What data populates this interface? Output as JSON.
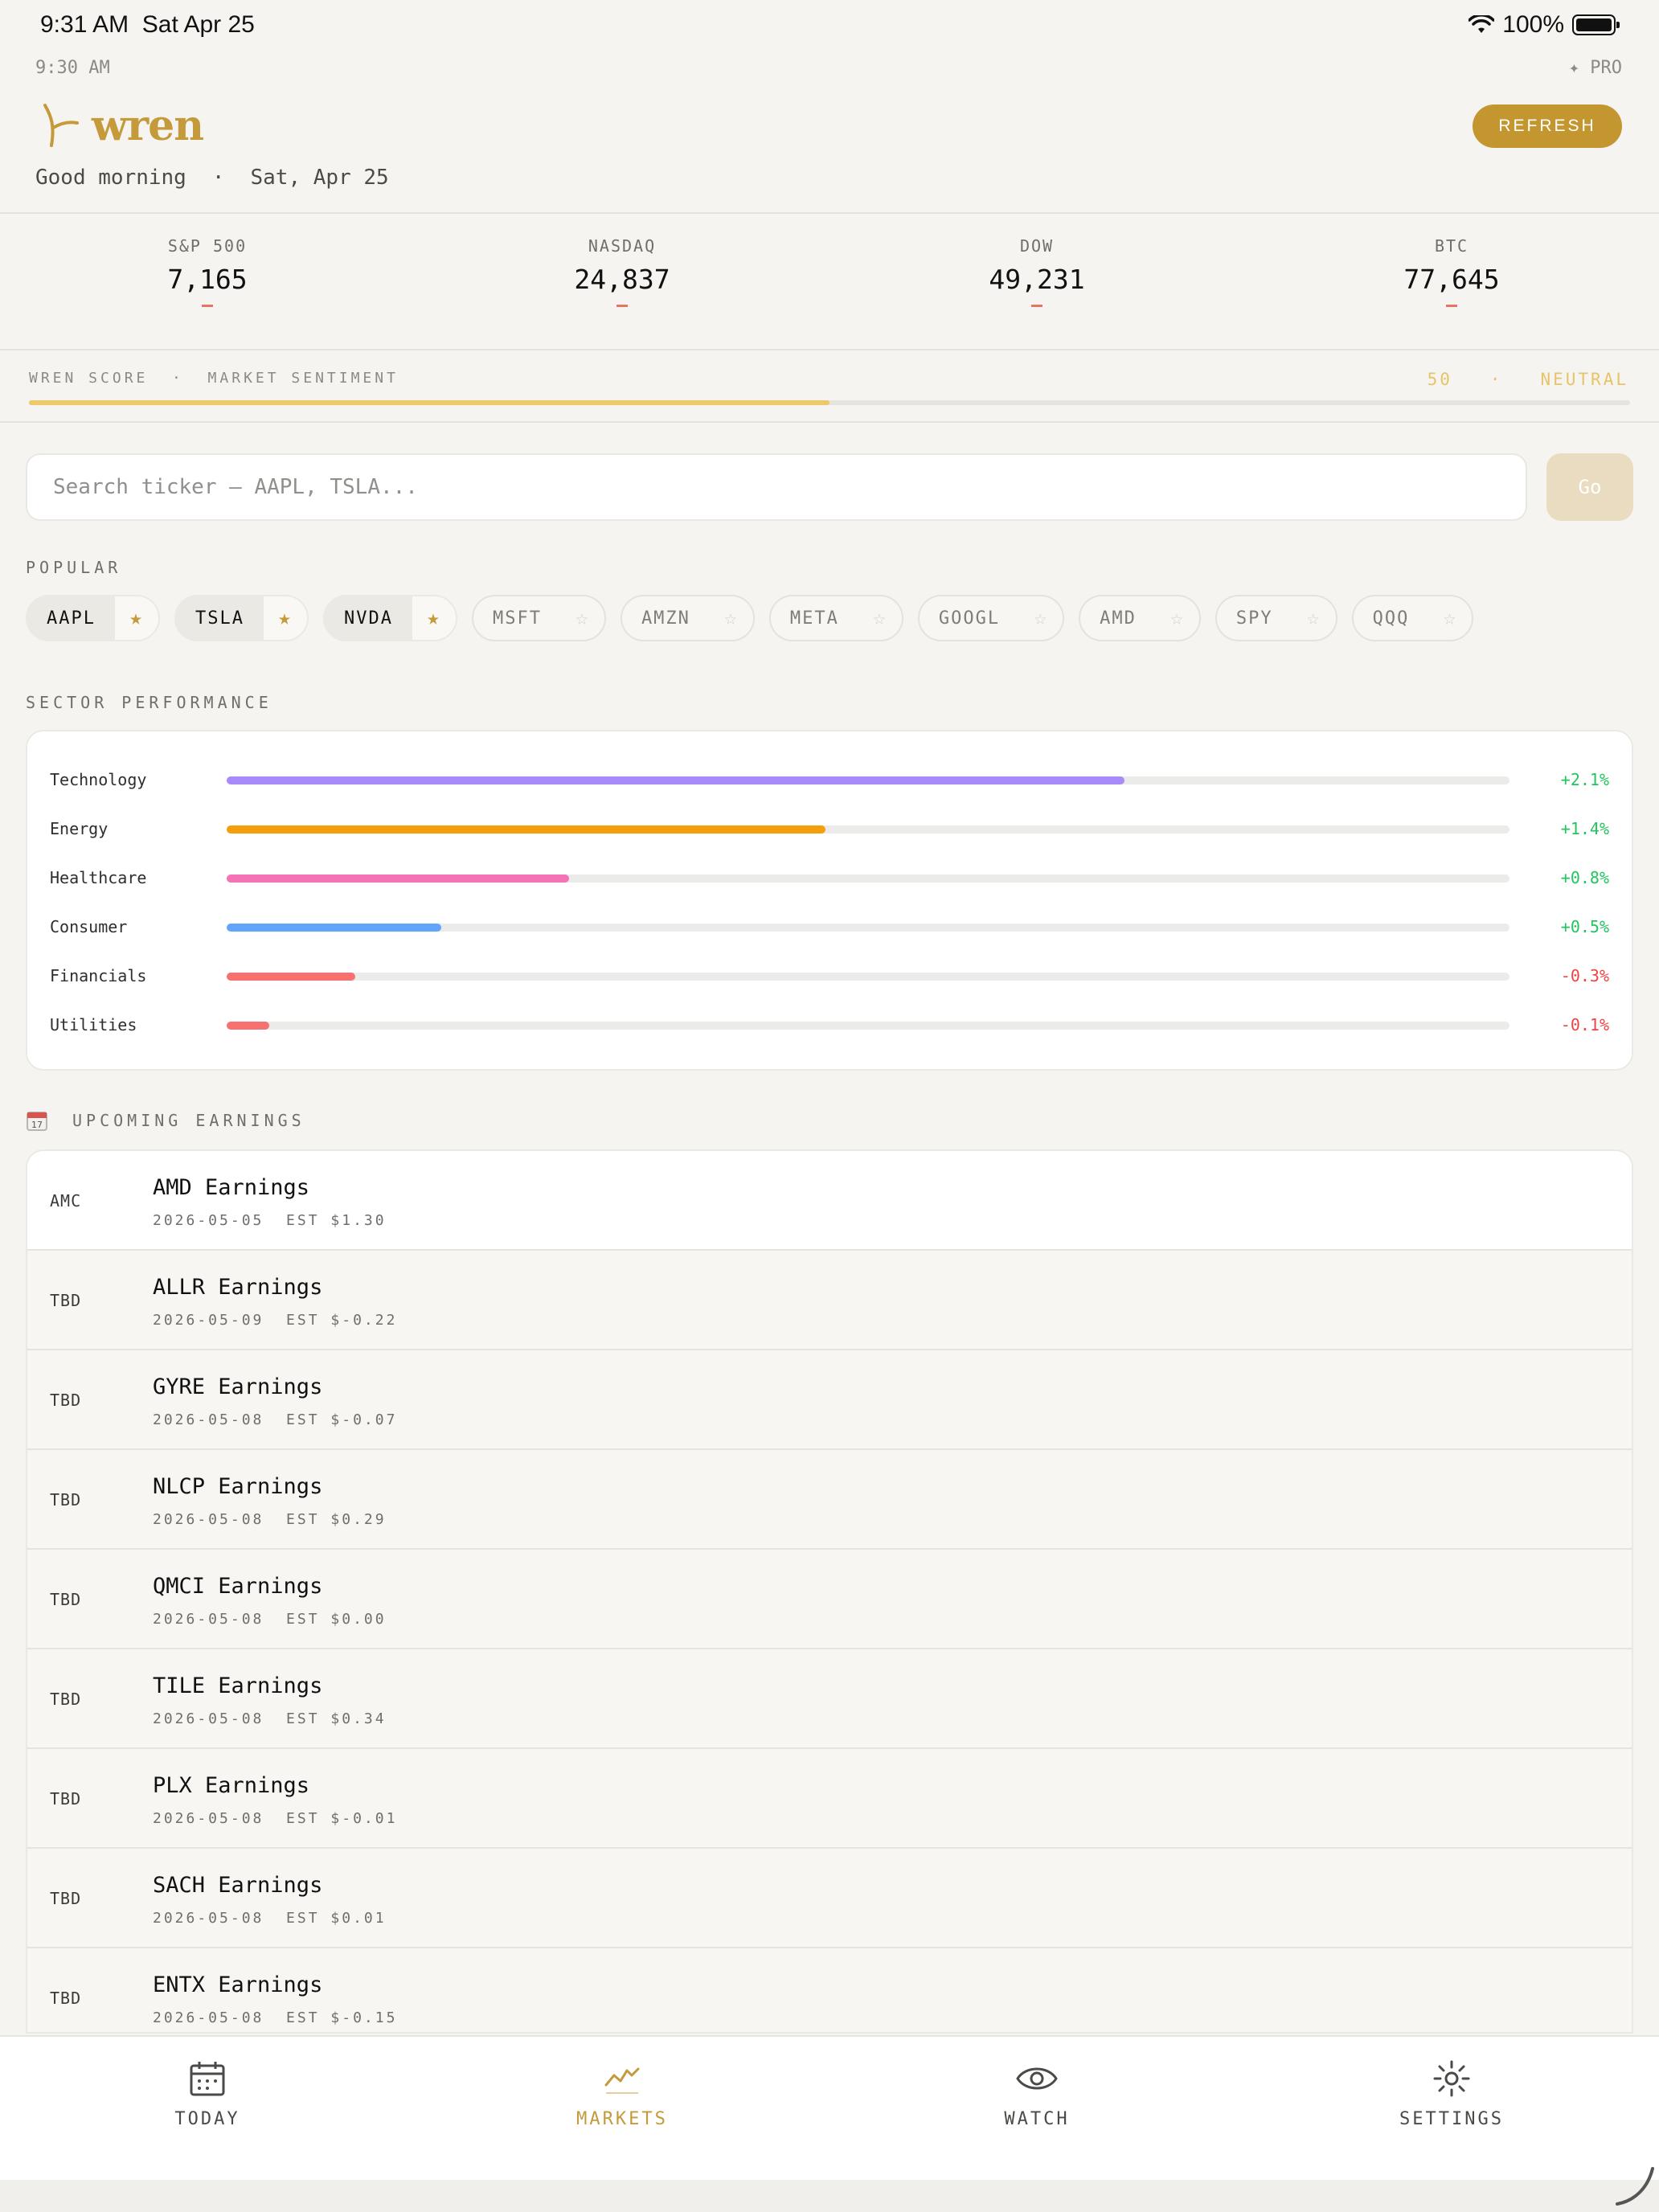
{
  "status_bar": {
    "time": "9:31 AM",
    "date": "Sat Apr 25",
    "battery": "100%"
  },
  "header": {
    "small_time": "9:30 AM",
    "pro_label": "✦ PRO",
    "app_name": "wren",
    "greeting": "Good morning",
    "separator": "·",
    "date": "Sat, Apr 25",
    "refresh_label": "REFRESH"
  },
  "indices": [
    {
      "name": "S&P 500",
      "value": "7,165",
      "change": "—"
    },
    {
      "name": "NASDAQ",
      "value": "24,837",
      "change": "—"
    },
    {
      "name": "DOW",
      "value": "49,231",
      "change": "—"
    },
    {
      "name": "BTC",
      "value": "77,645",
      "change": "—"
    }
  ],
  "score": {
    "label": "WREN SCORE  ·  MARKET SENTIMENT",
    "value": "50",
    "separator": "·",
    "sentiment": "NEUTRAL",
    "fraction": 0.5,
    "color": "#ecc96b"
  },
  "search": {
    "placeholder": "Search ticker — AAPL, TSLA...",
    "value": "",
    "go_label": "Go"
  },
  "popular": {
    "title": "POPULAR",
    "chips": [
      {
        "label": "AAPL",
        "favorite": true
      },
      {
        "label": "TSLA",
        "favorite": true
      },
      {
        "label": "NVDA",
        "favorite": true
      },
      {
        "label": "MSFT",
        "favorite": false
      },
      {
        "label": "AMZN",
        "favorite": false
      },
      {
        "label": "META",
        "favorite": false
      },
      {
        "label": "GOOGL",
        "favorite": false
      },
      {
        "label": "AMD",
        "favorite": false
      },
      {
        "label": "SPY",
        "favorite": false
      },
      {
        "label": "QQQ",
        "favorite": false
      }
    ]
  },
  "sectors": {
    "title": "SECTOR PERFORMANCE",
    "items": [
      {
        "name": "Technology",
        "change": "+2.1%",
        "fill_fraction": 0.7,
        "color": "#a78bfa",
        "value_color": "#22c55e"
      },
      {
        "name": "Energy",
        "change": "+1.4%",
        "fill_fraction": 0.467,
        "color": "#f59e0b",
        "value_color": "#22c55e"
      },
      {
        "name": "Healthcare",
        "change": "+0.8%",
        "fill_fraction": 0.267,
        "color": "#f472b6",
        "value_color": "#22c55e"
      },
      {
        "name": "Consumer",
        "change": "+0.5%",
        "fill_fraction": 0.167,
        "color": "#60a5fa",
        "value_color": "#22c55e"
      },
      {
        "name": "Financials",
        "change": "-0.3%",
        "fill_fraction": 0.1,
        "color": "#f87171",
        "value_color": "#ef4444"
      },
      {
        "name": "Utilities",
        "change": "-0.1%",
        "fill_fraction": 0.033,
        "color": "#f87171",
        "value_color": "#ef4444"
      }
    ]
  },
  "earnings": {
    "icon": "calendar-icon",
    "title": "UPCOMING EARNINGS",
    "items": [
      {
        "time": "AMC",
        "title": "AMD Earnings",
        "sub": "2026-05-05  EST $1.30"
      },
      {
        "time": "TBD",
        "title": "ALLR Earnings",
        "sub": "2026-05-09  EST $-0.22"
      },
      {
        "time": "TBD",
        "title": "GYRE Earnings",
        "sub": "2026-05-08  EST $-0.07"
      },
      {
        "time": "TBD",
        "title": "NLCP Earnings",
        "sub": "2026-05-08  EST $0.29"
      },
      {
        "time": "TBD",
        "title": "QMCI Earnings",
        "sub": "2026-05-08  EST $0.00"
      },
      {
        "time": "TBD",
        "title": "TILE Earnings",
        "sub": "2026-05-08  EST $0.34"
      },
      {
        "time": "TBD",
        "title": "PLX Earnings",
        "sub": "2026-05-08  EST $-0.01"
      },
      {
        "time": "TBD",
        "title": "SACH Earnings",
        "sub": "2026-05-08  EST $0.01"
      },
      {
        "time": "TBD",
        "title": "ENTX Earnings",
        "sub": "2026-05-08  EST $-0.15"
      }
    ]
  },
  "tabbar": {
    "items": [
      {
        "label": "TODAY",
        "icon": "calendar-icon",
        "active": false
      },
      {
        "label": "MARKETS",
        "icon": "chart-line-icon",
        "active": true
      },
      {
        "label": "WATCH",
        "icon": "eye-icon",
        "active": false
      },
      {
        "label": "SETTINGS",
        "icon": "gear-icon",
        "active": false
      }
    ]
  },
  "colors": {
    "accent": "#c4962f",
    "positive": "#22c55e",
    "negative": "#ef4444"
  }
}
